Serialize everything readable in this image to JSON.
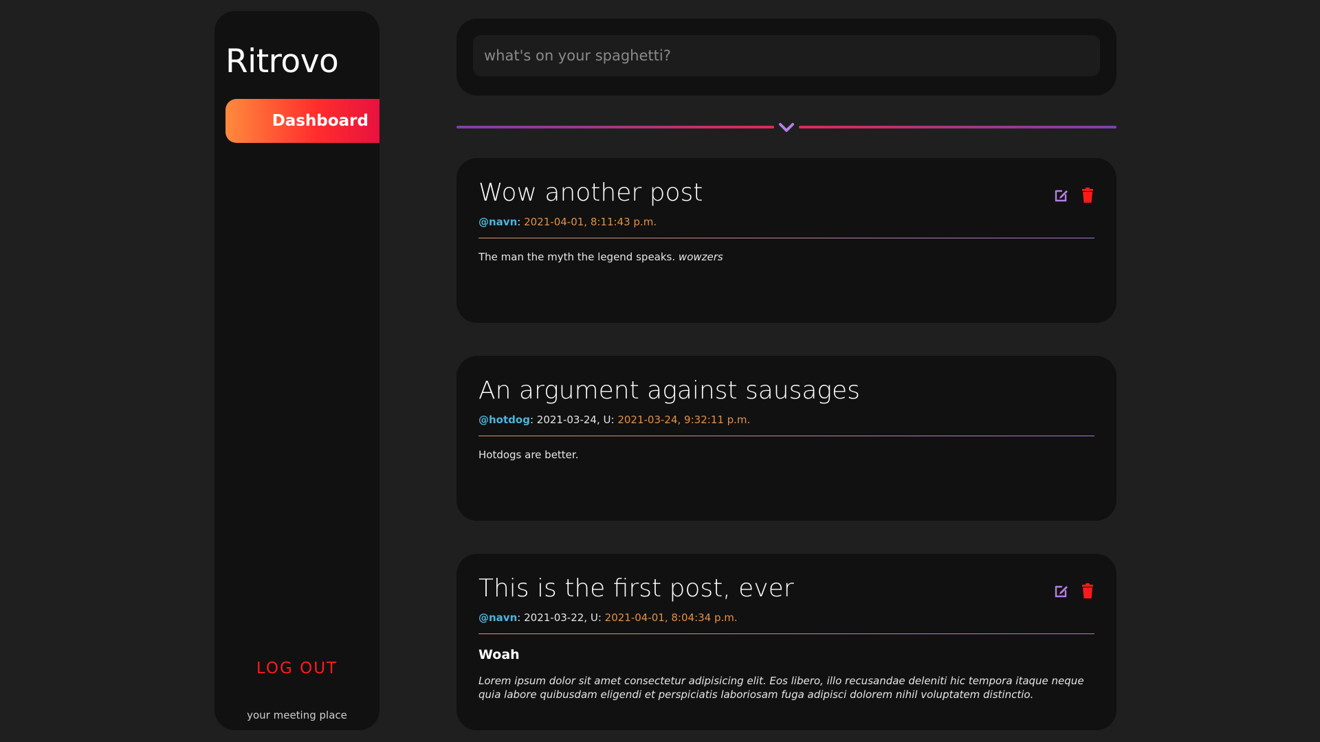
{
  "sidebar": {
    "brand": "Ritrovo",
    "nav": [
      {
        "label": "Dashboard",
        "active": true
      }
    ],
    "logout_label": "LOG OUT",
    "tagline": "your meeting place"
  },
  "composer": {
    "placeholder": "what's on your spaghetti?",
    "value": ""
  },
  "divider": {
    "icon": "chevron-down-icon"
  },
  "posts": [
    {
      "title": "Wow another post",
      "user": "@navn",
      "sep": ":",
      "created": "",
      "updated_prefix": "",
      "updated": "2021-04-01, 8:11:43 p.m.",
      "body": "The man the myth the legend speaks.",
      "body_emph": "wowzers",
      "actions": [
        "edit-icon",
        "trash-icon"
      ]
    },
    {
      "title": "An argument against sausages",
      "user": "@hotdog",
      "sep": ":",
      "created": "2021-03-24,",
      "updated_prefix": "U:",
      "updated": "2021-03-24, 9:32:11 p.m.",
      "body": "Hotdogs are better."
    },
    {
      "title": "This is the first post, ever",
      "user": "@navn",
      "sep": ":",
      "created": "2021-03-22,",
      "updated_prefix": "U:",
      "updated": "2021-04-01, 8:04:34 p.m.",
      "subhead": "Woah",
      "body": "Lorem ipsum dolor sit amet consectetur adipisicing elit. Eos libero, illo recusandae deleniti hic tempora itaque neque quia labore quibusdam eligendi et perspiciatis laboriosam fuga adipisci dolorem nihil voluptatem distinctio.",
      "actions": [
        "edit-icon",
        "trash-icon"
      ]
    }
  ],
  "colors": {
    "background": "#1f1f1f",
    "panel": "#111111",
    "accent_orange": "#ff8a3d",
    "accent_red": "#ff2c2c",
    "purple": "#a77ad6",
    "user_blue": "#4fb3d9",
    "date_orange": "#e0914a",
    "logout_red": "#ff1a1a"
  }
}
